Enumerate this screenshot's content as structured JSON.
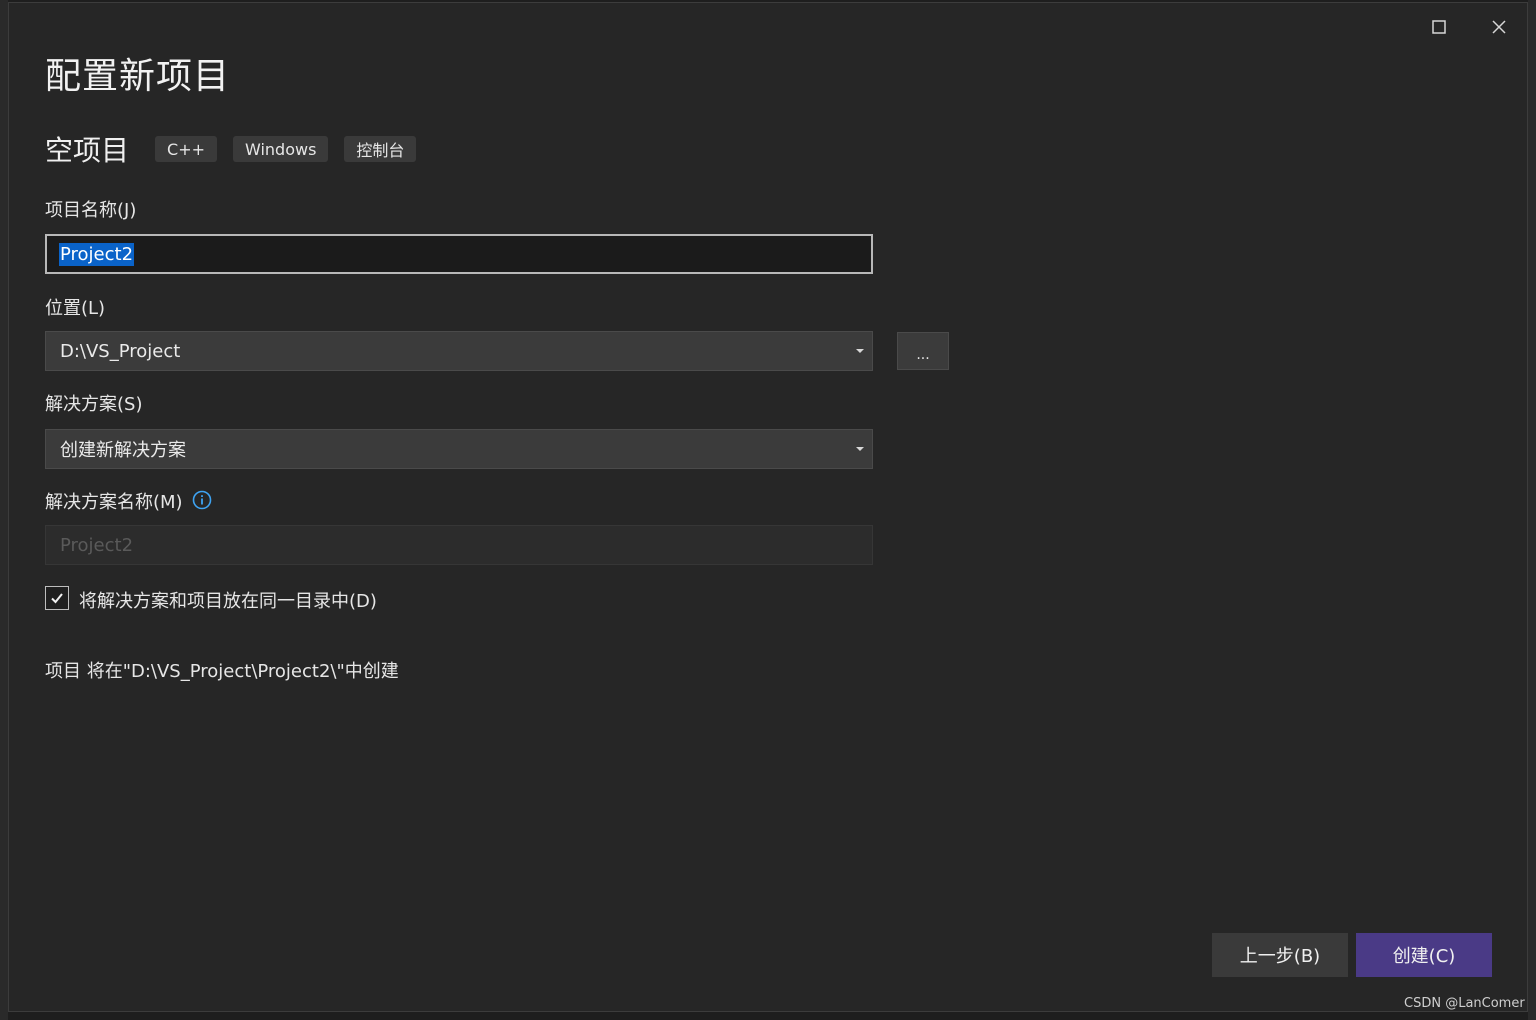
{
  "dialog": {
    "title": "配置新项目",
    "template_name": "空项目",
    "tags": [
      "C++",
      "Windows",
      "控制台"
    ]
  },
  "fields": {
    "project_name_label": "项目名称(J)",
    "project_name_value": "Project2",
    "location_label": "位置(L)",
    "location_value": "D:\\VS_Project",
    "browse_label": "...",
    "solution_label": "解决方案(S)",
    "solution_value": "创建新解决方案",
    "solution_name_label": "解决方案名称(M)",
    "solution_name_placeholder": "Project2",
    "same_dir_checkbox_label": "将解决方案和项目放在同一目录中(D)",
    "same_dir_checked": true,
    "info_text": "项目 将在\"D:\\VS_Project\\Project2\\\"中创建"
  },
  "buttons": {
    "back": "上一步(B)",
    "create": "创建(C)"
  },
  "icons": {
    "maximize": "maximize-icon",
    "close": "close-icon",
    "info": "info-icon",
    "dropdown": "chevron-down-icon",
    "check": "check-icon"
  },
  "colors": {
    "accent_create": "#4a3a86",
    "selection": "#0a63c9",
    "info_icon": "#3ea3f2"
  },
  "watermark": "CSDN @LanComer"
}
